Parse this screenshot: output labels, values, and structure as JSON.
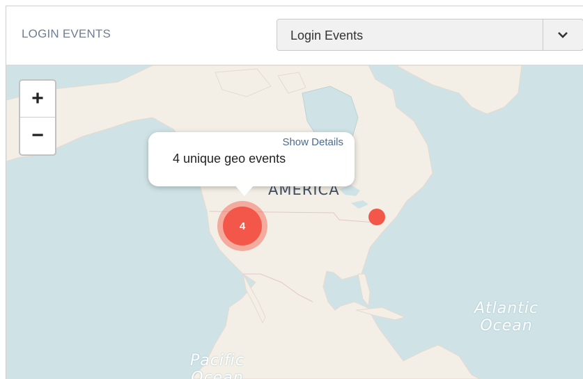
{
  "widget": {
    "title": "LOGIN EVENTS",
    "select": {
      "value": "Login Events",
      "icon": "chevron-down-icon"
    }
  },
  "map": {
    "zoom_in_label": "+",
    "zoom_out_label": "−",
    "popup": {
      "link": "Show Details",
      "text": "4 unique geo events"
    },
    "cluster": {
      "count": "4"
    },
    "labels": {
      "america": "AMERICA",
      "atlantic_1": "Atlantic",
      "atlantic_2": "Ocean",
      "pacific_1": "Pacific",
      "pacific_2": "Ocean"
    },
    "colors": {
      "water": "#cfe3e6",
      "land": "#f3efe6",
      "marker": "#f3574a"
    }
  }
}
